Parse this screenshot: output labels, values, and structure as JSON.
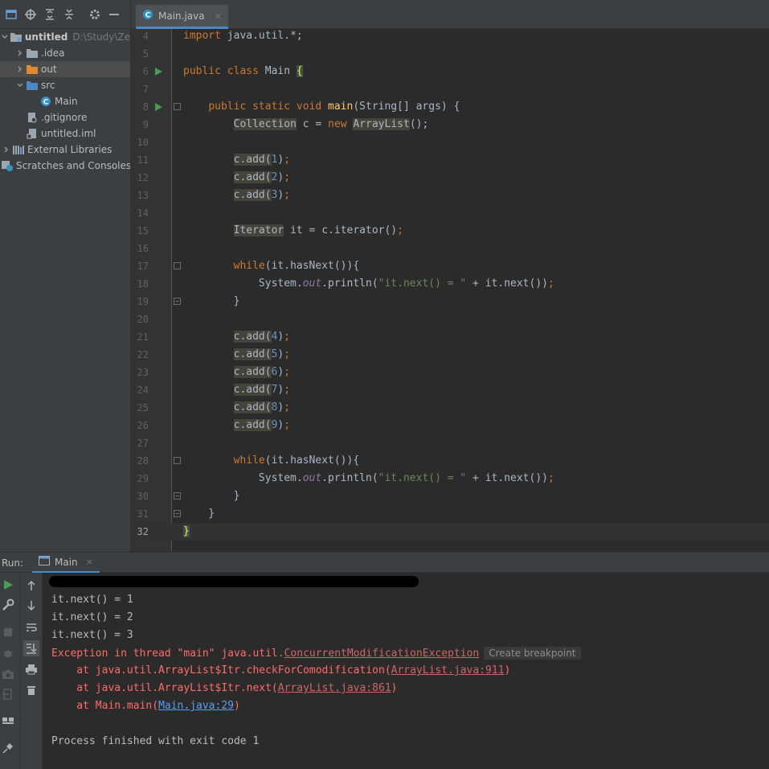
{
  "project": {
    "toolbar_icons": [
      "project-view-icon",
      "locate-icon",
      "expand-all-icon",
      "collapse-all-icon",
      "settings-icon",
      "hide-icon"
    ],
    "tree": [
      {
        "label": "untitled",
        "path": "D:\\Study\\Ze",
        "depth": 0,
        "arrow": "expanded",
        "icon": "folder-module-icon",
        "bold": true
      },
      {
        "label": ".idea",
        "depth": 1,
        "arrow": "collapsed",
        "icon": "folder-icon"
      },
      {
        "label": "out",
        "depth": 1,
        "arrow": "collapsed",
        "icon": "folder-orange-icon",
        "selected": true
      },
      {
        "label": "src",
        "depth": 1,
        "arrow": "expanded",
        "icon": "folder-blue-icon"
      },
      {
        "label": "Main",
        "depth": 2,
        "icon": "java-class-icon"
      },
      {
        "label": ".gitignore",
        "depth": 1,
        "icon": "gitignore-icon"
      },
      {
        "label": "untitled.iml",
        "depth": 1,
        "icon": "iml-icon"
      },
      {
        "label": "External Libraries",
        "depth": 0,
        "arrow": "collapsed",
        "icon": "libraries-icon"
      },
      {
        "label": "Scratches and Consoles",
        "depth": 0,
        "icon": "scratches-icon"
      }
    ]
  },
  "editor": {
    "tab_label": "Main.java",
    "tab_close": "×",
    "lines": [
      {
        "n": "4",
        "html": "<span class=\"kw\">import </span>java.util.*;"
      },
      {
        "n": "5",
        "html": ""
      },
      {
        "n": "6",
        "run": true,
        "html": "<span class=\"kw\">public class </span>Main <span class=\"brace-hl\">{</span>"
      },
      {
        "n": "7",
        "html": ""
      },
      {
        "n": "8",
        "run": true,
        "fold": "start",
        "html": "    <span class=\"kw\">public static void </span><span class=\"fn\">main</span>(String[] args) {"
      },
      {
        "n": "9",
        "html": "        <span class=\"warn\">Collection</span> c = <span class=\"kw\">new </span><span class=\"warn\">ArrayList</span>();"
      },
      {
        "n": "10",
        "html": ""
      },
      {
        "n": "11",
        "html": "        <span class=\"warn\">c.add(</span><span class=\"num\">1</span>)<span class=\"kw\">;</span>"
      },
      {
        "n": "12",
        "html": "        <span class=\"warn\">c.add(</span><span class=\"num\">2</span>)<span class=\"kw\">;</span>"
      },
      {
        "n": "13",
        "html": "        <span class=\"warn\">c.add(</span><span class=\"num\">3</span>)<span class=\"kw\">;</span>"
      },
      {
        "n": "14",
        "html": ""
      },
      {
        "n": "15",
        "html": "        <span class=\"warn\">Iterator</span> it = c.iterator()<span class=\"kw\">;</span>"
      },
      {
        "n": "16",
        "html": ""
      },
      {
        "n": "17",
        "fold": "start",
        "html": "        <span class=\"kw\">while</span>(it.hasNext()){"
      },
      {
        "n": "18",
        "html": "            System.<span class=\"ital\">out</span>.println(<span class=\"str\">\"it.next() = \"</span> + it.next())<span class=\"kw\">;</span>"
      },
      {
        "n": "19",
        "fold": "end",
        "html": "        }"
      },
      {
        "n": "20",
        "html": ""
      },
      {
        "n": "21",
        "html": "        <span class=\"warn\">c.add(</span><span class=\"num\">4</span>)<span class=\"kw\">;</span>"
      },
      {
        "n": "22",
        "html": "        <span class=\"warn\">c.add(</span><span class=\"num\">5</span>)<span class=\"kw\">;</span>"
      },
      {
        "n": "23",
        "html": "        <span class=\"warn\">c.add(</span><span class=\"num\">6</span>)<span class=\"kw\">;</span>"
      },
      {
        "n": "24",
        "html": "        <span class=\"warn\">c.add(</span><span class=\"num\">7</span>)<span class=\"kw\">;</span>"
      },
      {
        "n": "25",
        "html": "        <span class=\"warn\">c.add(</span><span class=\"num\">8</span>)<span class=\"kw\">;</span>"
      },
      {
        "n": "26",
        "html": "        <span class=\"warn\">c.add(</span><span class=\"num\">9</span>)<span class=\"kw\">;</span>"
      },
      {
        "n": "27",
        "html": ""
      },
      {
        "n": "28",
        "fold": "start",
        "html": "        <span class=\"kw\">while</span>(it.hasNext()){"
      },
      {
        "n": "29",
        "html": "            System.<span class=\"ital\">out</span>.println(<span class=\"str\">\"it.next() = \"</span> + it.next())<span class=\"kw\">;</span>"
      },
      {
        "n": "30",
        "fold": "end",
        "html": "        }"
      },
      {
        "n": "31",
        "fold": "end",
        "html": "    }"
      },
      {
        "n": "32",
        "current": true,
        "html": "<span class=\"brace-hl\">}</span>"
      }
    ]
  },
  "run": {
    "label": "Run:",
    "tab_label": "Main",
    "tab_close": "×",
    "output": [
      {
        "text": "it.next() = 1"
      },
      {
        "text": "it.next() = 2"
      },
      {
        "text": "it.next() = 3"
      },
      {
        "err": true,
        "pre": "Exception in thread \"main\" java.util.",
        "link": "ConcurrentModificationException",
        "hint": "Create breakpoint"
      },
      {
        "err": true,
        "pre": "    at java.util.ArrayList$Itr.checkForComodification(",
        "ulink": "ArrayList.java:911",
        "post": ")"
      },
      {
        "err": true,
        "pre": "    at java.util.ArrayList$Itr.next(",
        "ulink": "ArrayList.java:861",
        "post": ")"
      },
      {
        "err": true,
        "pre": "    at Main.main(",
        "blink": "Main.java:29",
        "post": ")"
      },
      {
        "text": ""
      },
      {
        "text": "Process finished with exit code 1"
      }
    ]
  },
  "colors": {
    "keyword": "#cc7832",
    "function": "#ffc66d",
    "number": "#6897bb",
    "string": "#6a8759",
    "error": "#ff6b68",
    "link": "#589df6",
    "accent": "#4a88c7",
    "run_green": "#499c54"
  }
}
